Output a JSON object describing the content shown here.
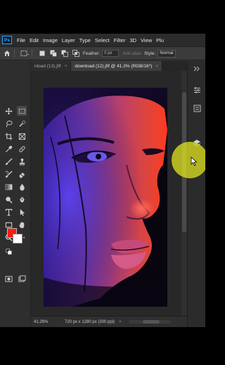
{
  "menu": {
    "logo": "Ps",
    "items": [
      "File",
      "Edit",
      "Image",
      "Layer",
      "Type",
      "Select",
      "Filter",
      "3D",
      "View",
      "Plu"
    ]
  },
  "options": {
    "feather_label": "Feather:",
    "feather_value": "0 px",
    "antialias_label": "Anti-alias",
    "style_label": "Style:",
    "style_value": "Normal"
  },
  "tabs": [
    {
      "label": "nload (13).jfif",
      "close": "×",
      "active": false
    },
    {
      "label": "download (12).jfif @ 41.3% (RGB/16*)",
      "close": "×",
      "active": true
    }
  ],
  "status": {
    "zoom": "41.26%",
    "doc_info": "720 px x 1280 px (300 ppi)",
    "arrow": ">"
  },
  "colors": {
    "foreground": "#ff1a10",
    "background": "#ffffff",
    "cursor_highlight": "#e8ec1e"
  },
  "tools": [
    "move-tool-icon",
    "artboard-tool-icon",
    "lasso-tool-icon",
    "quick-select-tool-icon",
    "crop-tool-icon",
    "frame-tool-icon",
    "eyedropper-tool-icon",
    "healing-brush-icon",
    "brush-tool-icon",
    "clone-stamp-icon",
    "history-brush-icon",
    "eraser-tool-icon",
    "gradient-tool-icon",
    "blur-tool-icon",
    "dodge-tool-icon",
    "pen-tool-icon",
    "type-tool-icon",
    "path-select-icon",
    "rectangle-tool-icon",
    "hand-tool-icon",
    "zoom-tool-icon",
    "edit-toolbar-icon"
  ]
}
